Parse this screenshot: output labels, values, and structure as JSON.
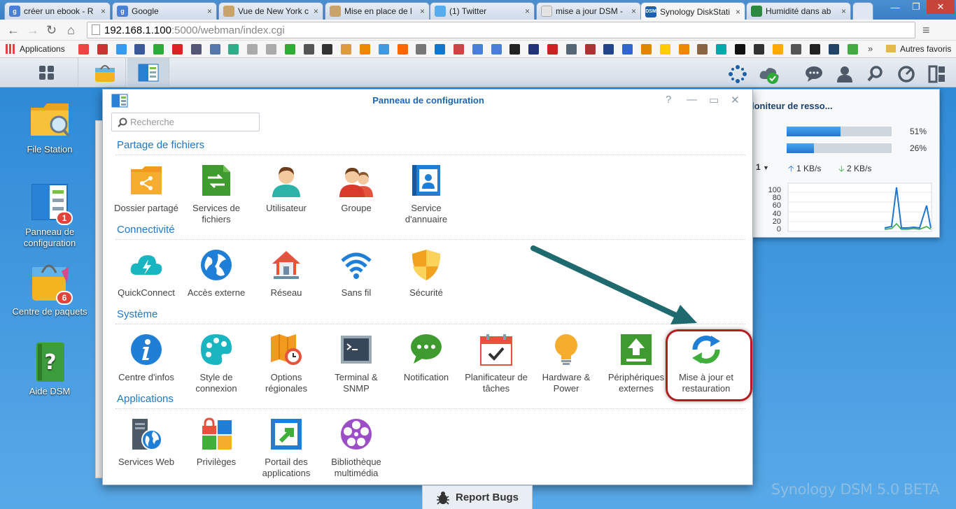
{
  "browser": {
    "tabs": [
      {
        "title": "créer un ebook - R",
        "color": "#4a7fd8",
        "glyph": "g"
      },
      {
        "title": "Google",
        "color": "#4a7fd8",
        "glyph": "g"
      },
      {
        "title": "Vue de New York c",
        "color": "#c9a46a",
        "glyph": ""
      },
      {
        "title": "Mise en place de l",
        "color": "#c9a46a",
        "glyph": ""
      },
      {
        "title": "(1) Twitter",
        "color": "#55acee",
        "glyph": ""
      },
      {
        "title": "mise a jour DSM -",
        "color": "#e4e4e4",
        "glyph": ""
      },
      {
        "title": "Synology DiskStati",
        "color": "#1a5fb4",
        "glyph": "DSM"
      },
      {
        "title": "Humidité dans ab",
        "color": "#2b8a3e",
        "glyph": ""
      }
    ],
    "url_host": "192.168.1.100",
    "url_path": ":5000/webman/index.cgi",
    "bookmarks_apps": "Applications",
    "bookmarks_other": "Autres favoris",
    "bookmarks_more": "»"
  },
  "desktop": {
    "icons": [
      {
        "label": "File Station",
        "badge": ""
      },
      {
        "label": "Panneau de configuration",
        "badge": "1"
      },
      {
        "label": "Centre de paquets",
        "badge": "6"
      },
      {
        "label": "Aide DSM",
        "badge": ""
      }
    ]
  },
  "resmon": {
    "title": "loniteur de resso...",
    "cpu_pct": "51%",
    "cpu": 0.51,
    "ram_pct": "26%",
    "ram": 0.26,
    "net_sel": "1",
    "up": "1 KB/s",
    "down": "2 KB/s",
    "yticks": [
      "100",
      "80",
      "60",
      "40",
      "20",
      "0"
    ]
  },
  "cp": {
    "title": "Panneau de configuration",
    "search_placeholder": "Recherche",
    "sections": {
      "partage": {
        "title": "Partage de fichiers",
        "items": [
          "Dossier partagé",
          "Services de fichiers",
          "Utilisateur",
          "Groupe",
          "Service d'annuaire"
        ]
      },
      "connect": {
        "title": "Connectivité",
        "items": [
          "QuickConnect",
          "Accès externe",
          "Réseau",
          "Sans fil",
          "Sécurité"
        ]
      },
      "systeme": {
        "title": "Système",
        "items": [
          "Centre d'infos",
          "Style de connexion",
          "Options régionales",
          "Terminal & SNMP",
          "Notification",
          "Planificateur de tâches",
          "Hardware & Power",
          "Périphériques externes",
          "Mise à jour et restauration"
        ]
      },
      "apps": {
        "title": "Applications",
        "items": [
          "Services Web",
          "Privilèges",
          "Portail des applications",
          "Bibliothèque multimédia"
        ]
      }
    }
  },
  "report_bugs": "Report Bugs",
  "brand": "Synology DSM 5.0 BETA",
  "colors": {
    "accent": "#1e77c8",
    "highlight": "#b01e22",
    "arrow": "#1f6a6e"
  }
}
